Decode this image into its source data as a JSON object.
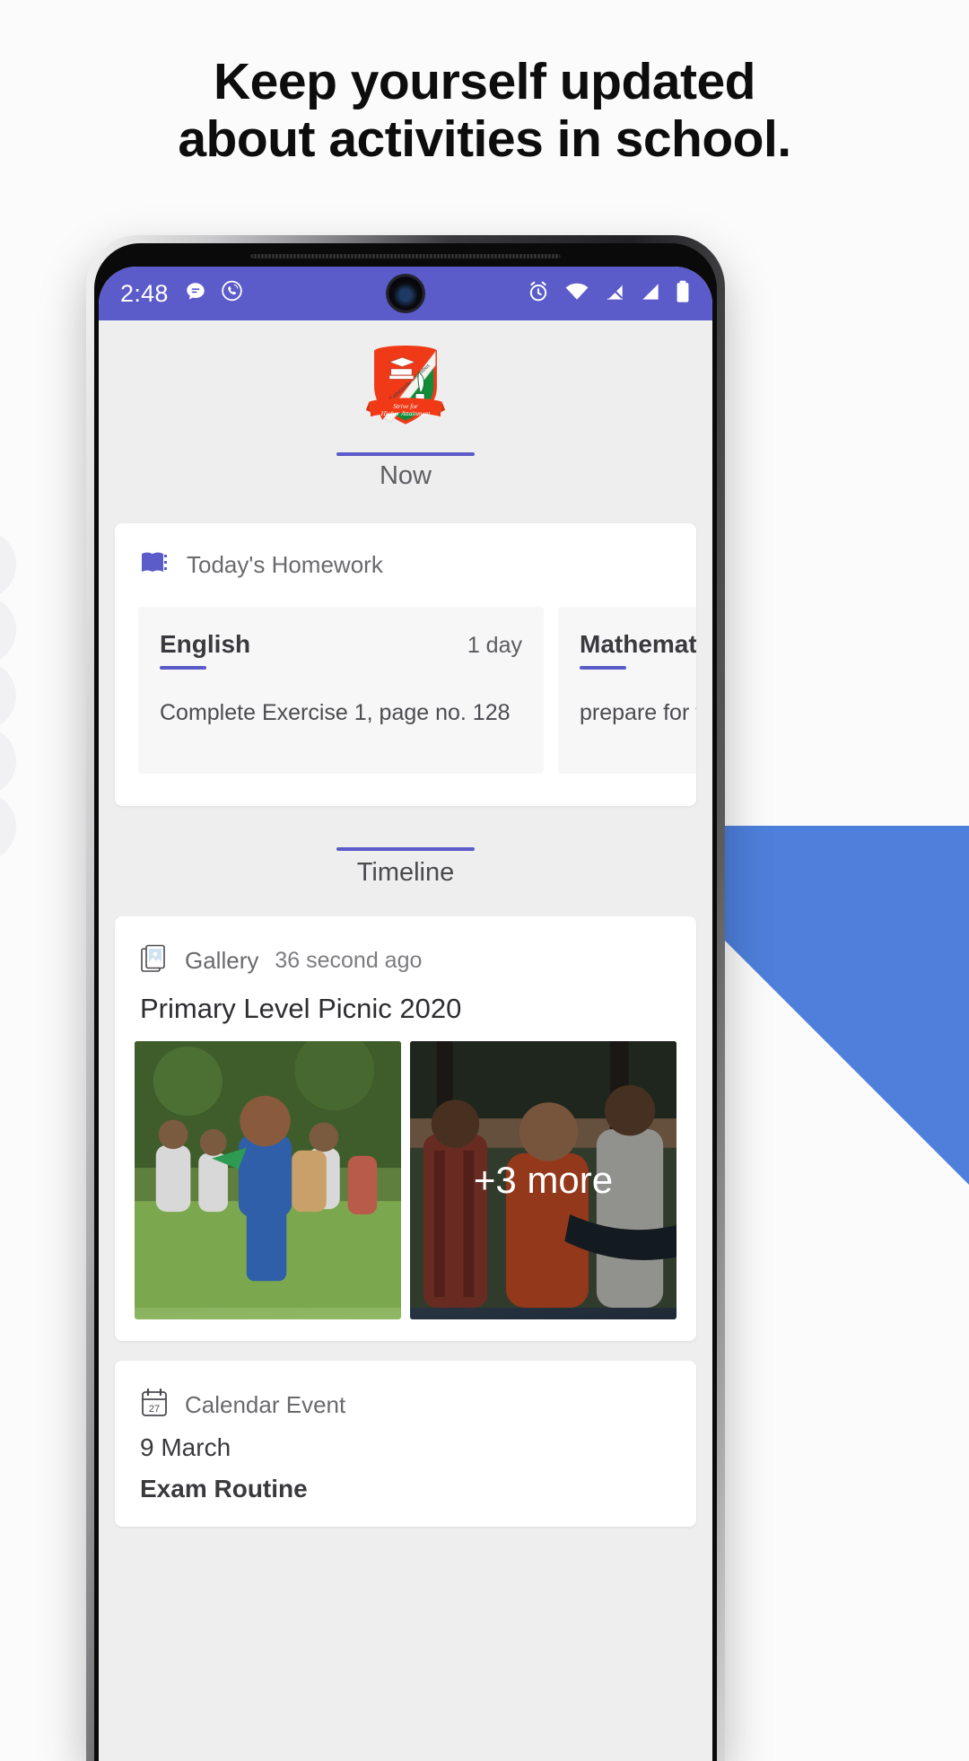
{
  "promo": {
    "headline_line1": "Keep yourself updated",
    "headline_line2": "about activities in school."
  },
  "status_bar": {
    "time": "2:48",
    "left_icons": [
      "message-icon",
      "viber-icon"
    ],
    "right_icons": [
      "alarm-icon",
      "wifi-icon",
      "signal-muted-icon",
      "signal-icon",
      "battery-icon"
    ],
    "background_color": "#5b5bc9"
  },
  "app": {
    "logo_name": "school-crest-logo",
    "tabs": [
      {
        "label": "Now",
        "active": true
      },
      {
        "label": "Timeline",
        "active": true
      }
    ],
    "homework_card": {
      "icon": "book-icon",
      "title": "Today's Homework",
      "items": [
        {
          "subject": "English",
          "due": "1 day",
          "description": "Complete Exercise 1, page no. 128"
        },
        {
          "subject": "Mathematic",
          "due": "",
          "description": "prepare for te"
        }
      ]
    },
    "timeline_label": "Timeline",
    "gallery_post": {
      "icon": "gallery-icon",
      "source": "Gallery",
      "time": "36 second ago",
      "title": "Primary Level Picnic 2020",
      "photos_count_label": "+3 more"
    },
    "calendar_post": {
      "icon": "calendar-icon",
      "source": "Calendar Event",
      "date": "9 March",
      "event": "Exam Routine"
    }
  },
  "theme": {
    "accent": "#5b5bc9",
    "screen_bg": "#eeeeef",
    "card_bg": "#ffffff",
    "wedge_blue": "#4d7fdb"
  }
}
